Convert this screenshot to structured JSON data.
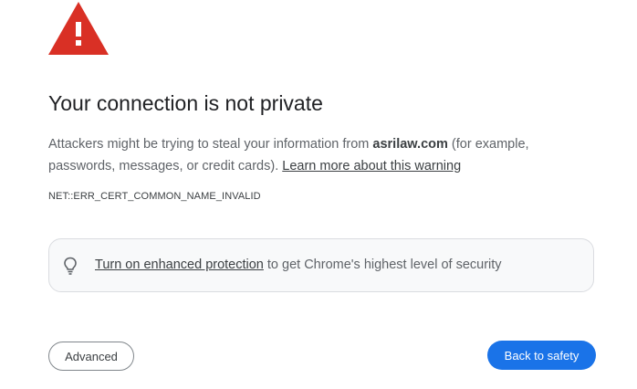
{
  "colors": {
    "warning_red": "#d93025",
    "accent_blue": "#1a73e8",
    "text_primary": "#202124",
    "text_secondary": "#5f6368"
  },
  "icons": {
    "warning": "warning-triangle-icon",
    "bulb": "lightbulb-icon"
  },
  "title": "Your connection is not private",
  "message": {
    "prefix": "Attackers might be trying to steal your information from ",
    "domain": "asrilaw.com",
    "suffix": " (for example, passwords, messages, or credit cards). ",
    "learn_more_link": "Learn more about this warning"
  },
  "error_code": "NET::ERR_CERT_COMMON_NAME_INVALID",
  "protection": {
    "link_text": "Turn on enhanced protection",
    "suffix": " to get Chrome's highest level of security"
  },
  "buttons": {
    "advanced": "Advanced",
    "back_to_safety": "Back to safety"
  }
}
